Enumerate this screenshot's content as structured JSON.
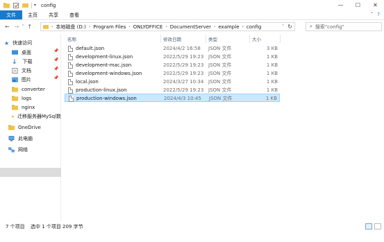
{
  "window": {
    "title": "config",
    "controls": {
      "minimize": "—",
      "maximize": "☐",
      "close": "✕"
    }
  },
  "ribbon": {
    "tabs": [
      "文件",
      "主页",
      "共享",
      "查看"
    ],
    "expand_icon": "˅",
    "help_icon": "?"
  },
  "address": {
    "back": "←",
    "forward": "→",
    "recent": "˅",
    "up": "↑",
    "crumbs": [
      "本地磁盘 (D:)",
      "Program Files",
      "ONLYOFFICE",
      "DocumentServer",
      "example",
      "config"
    ],
    "separator": "›",
    "refresh": "↻"
  },
  "search": {
    "placeholder": "搜索\"config\"",
    "icon": "search-icon"
  },
  "sidebar": {
    "items": [
      {
        "label": "快速访问",
        "icon": "star-icon",
        "pinned": false
      },
      {
        "label": "桌面",
        "icon": "desktop-folder-icon",
        "pinned": true
      },
      {
        "label": "下载",
        "icon": "download-folder-icon",
        "pinned": true
      },
      {
        "label": "文档",
        "icon": "documents-folder-icon",
        "pinned": true
      },
      {
        "label": "图片",
        "icon": "pictures-folder-icon",
        "pinned": true
      },
      {
        "label": "converter",
        "icon": "folder-icon",
        "pinned": false
      },
      {
        "label": "logs",
        "icon": "folder-icon",
        "pinned": false
      },
      {
        "label": "nginx",
        "icon": "folder-icon",
        "pinned": false
      },
      {
        "label": "迁移服务器MySql数",
        "icon": "folder-icon",
        "pinned": false
      },
      {
        "label": "OneDrive",
        "icon": "cloud-icon",
        "pinned": false
      },
      {
        "label": "此电脑",
        "icon": "computer-icon",
        "pinned": false
      },
      {
        "label": "网络",
        "icon": "network-icon",
        "pinned": false
      }
    ],
    "pin_glyph": "📌"
  },
  "columns": {
    "name": "名称",
    "date": "修改日期",
    "type": "类型",
    "size": "大小"
  },
  "files": [
    {
      "name": "default.json",
      "date": "2024/4/2 16:58",
      "type": "JSON 文件",
      "size": "3 KB",
      "selected": false
    },
    {
      "name": "development-linux.json",
      "date": "2022/5/29 19:23",
      "type": "JSON 文件",
      "size": "1 KB",
      "selected": false
    },
    {
      "name": "development-mac.json",
      "date": "2022/5/29 19:23",
      "type": "JSON 文件",
      "size": "1 KB",
      "selected": false
    },
    {
      "name": "development-windows.json",
      "date": "2022/5/29 19:23",
      "type": "JSON 文件",
      "size": "1 KB",
      "selected": false
    },
    {
      "name": "local.json",
      "date": "2024/3/27 10:34",
      "type": "JSON 文件",
      "size": "1 KB",
      "selected": false
    },
    {
      "name": "production-linux.json",
      "date": "2022/5/29 19:23",
      "type": "JSON 文件",
      "size": "1 KB",
      "selected": false
    },
    {
      "name": "production-windows.json",
      "date": "2024/4/3 10:45",
      "type": "JSON 文件",
      "size": "1 KB",
      "selected": true
    }
  ],
  "status": {
    "count": "7 个项目",
    "selected": "选中 1 个项目",
    "size": "209 字节"
  },
  "colors": {
    "accent": "#1979ca",
    "selection": "#cce8ff",
    "folder": "#f0c24a"
  }
}
